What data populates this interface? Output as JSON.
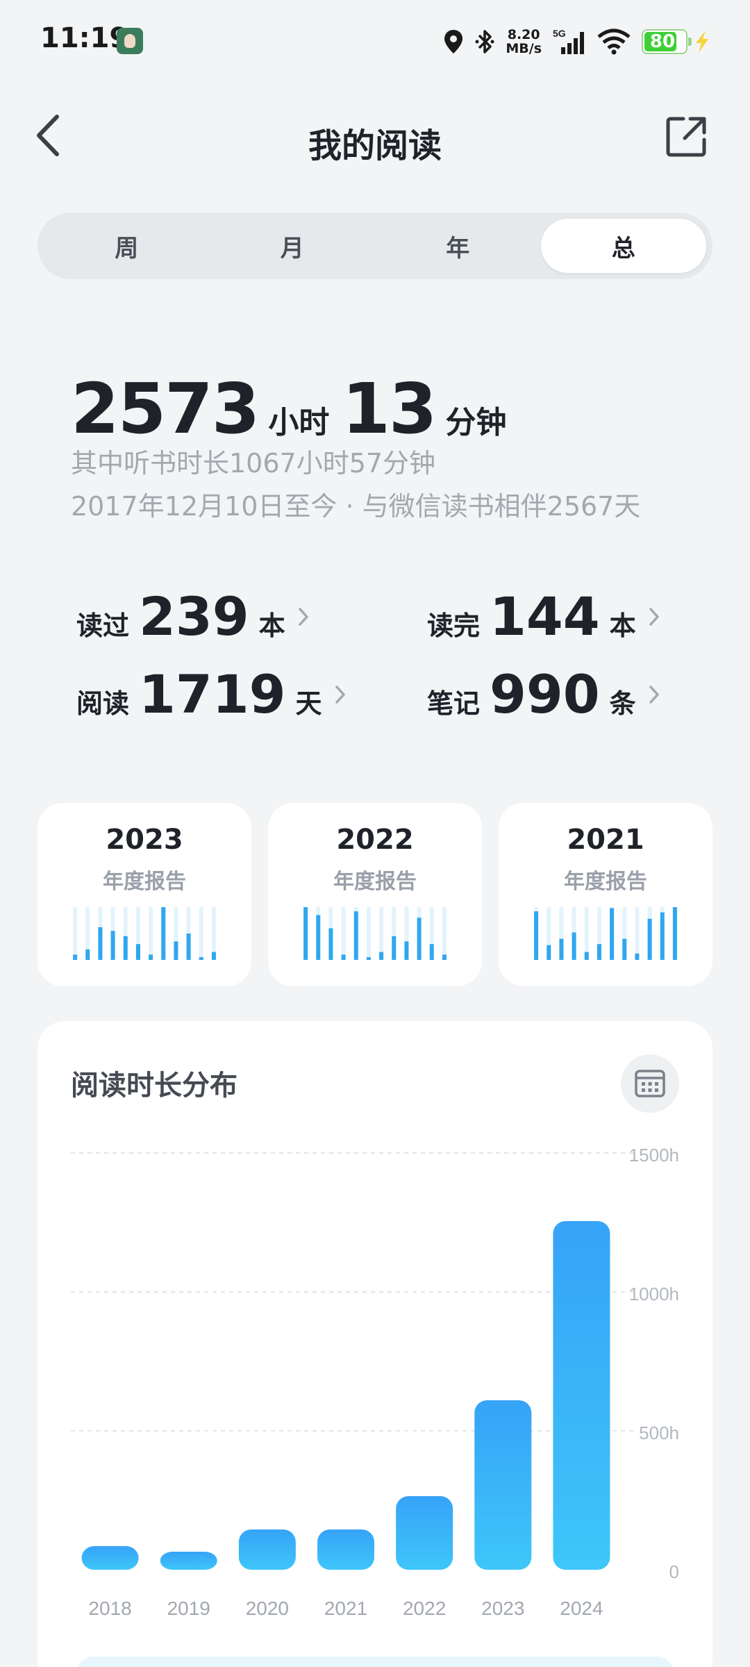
{
  "status_bar": {
    "time": "11:19",
    "net_speed_value": "8.20",
    "net_speed_unit": "MB/s",
    "network_type": "5G",
    "battery": "80",
    "battery_level": 0.8
  },
  "header": {
    "title": "我的阅读"
  },
  "tabs": [
    {
      "label": "周",
      "active": false
    },
    {
      "label": "月",
      "active": false
    },
    {
      "label": "年",
      "active": false
    },
    {
      "label": "总",
      "active": true
    }
  ],
  "summary": {
    "hours": "2573",
    "hours_unit": "小时",
    "minutes": "13",
    "minutes_unit": "分钟",
    "listen_line": "其中听书时长1067小时57分钟",
    "since_line": "2017年12月10日至今 · 与微信读书相伴2567天"
  },
  "stats": {
    "read": {
      "label": "读过",
      "value": "239",
      "unit": "本"
    },
    "finished": {
      "label": "读完",
      "value": "144",
      "unit": "本"
    },
    "days": {
      "label": "阅读",
      "value": "1719",
      "unit": "天"
    },
    "notes": {
      "label": "笔记",
      "value": "990",
      "unit": "条"
    }
  },
  "reports": [
    {
      "year": "2023",
      "label": "年度报告",
      "bars": [
        0.1,
        0.2,
        0.62,
        0.55,
        0.45,
        0.3,
        0.1,
        1.0,
        0.35,
        0.5,
        0.05,
        0.15
      ]
    },
    {
      "year": "2022",
      "label": "年度报告",
      "bars": [
        1.0,
        0.85,
        0.6,
        0.1,
        0.92,
        0.05,
        0.15,
        0.45,
        0.35,
        0.8,
        0.3,
        0.1
      ]
    },
    {
      "year": "2021",
      "label": "年度报告",
      "bars": [
        0.92,
        0.28,
        0.4,
        0.52,
        0.15,
        0.3,
        0.98,
        0.4,
        0.12,
        0.78,
        0.9,
        1.0
      ]
    }
  ],
  "distribution": {
    "title": "阅读时长分布"
  },
  "chart_data": {
    "type": "bar",
    "title": "阅读时长分布",
    "categories": [
      "2018",
      "2019",
      "2020",
      "2021",
      "2022",
      "2023",
      "2024"
    ],
    "values": [
      85,
      65,
      145,
      145,
      265,
      610,
      1255
    ],
    "ylim": [
      0,
      1500
    ],
    "y_ticks": [
      "0",
      "500h",
      "1000h",
      "1500h"
    ],
    "y_tick_values": [
      0,
      500,
      1000,
      1500
    ],
    "grid": true,
    "bar_color_top": "#36a3f7",
    "bar_color_bottom": "#3ec6f9"
  },
  "colors": {
    "accent": "#36a3f7",
    "report_bar": "#2fa7ef",
    "report_bar_bg": "#e3f3fb",
    "background": "#f2f4f6"
  }
}
